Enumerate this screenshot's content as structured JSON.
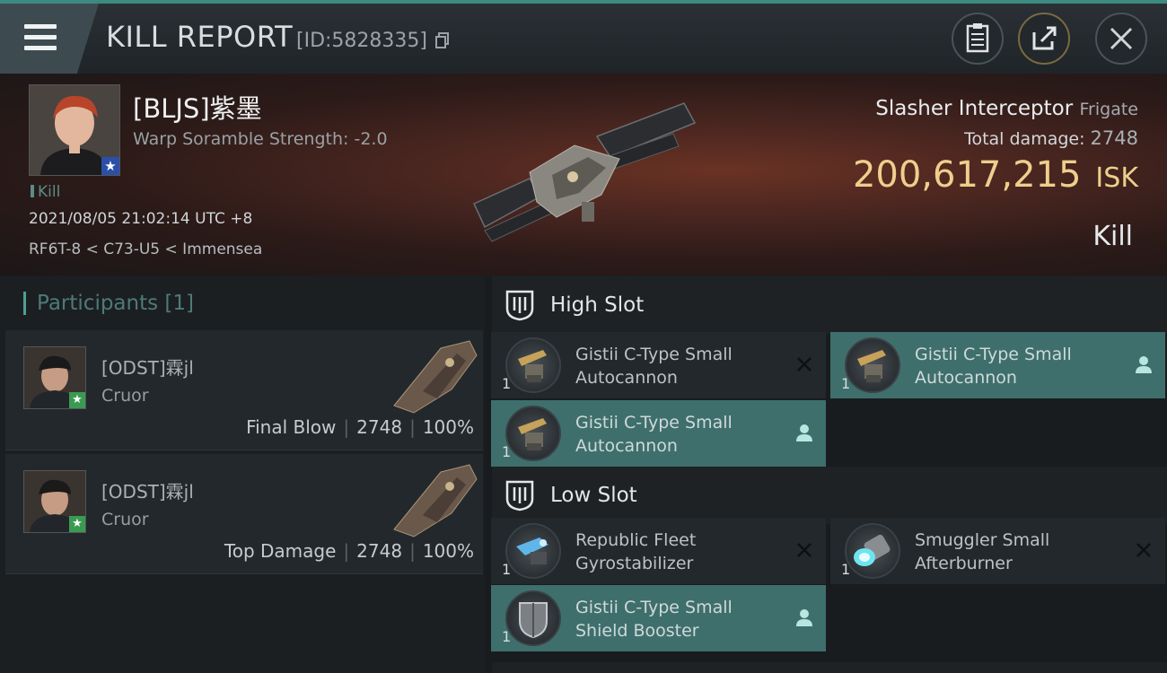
{
  "window": {
    "title": "KILL REPORT",
    "kill_id": "[ID:5828335]"
  },
  "victim": {
    "name": "[BLJS]紫墨",
    "warp_scramble": "Warp Soramble Strength: -2.0",
    "tag": "Kill",
    "datetime": "2021/08/05 21:02:14 UTC +8",
    "location": "RF6T-8 < C73-U5 < Immensea"
  },
  "ship": {
    "name": "Slasher Interceptor",
    "class": "Frigate",
    "total_damage_label": "Total damage:",
    "total_damage": "2748",
    "isk_value": "200,617,215",
    "isk_unit": "ISK",
    "result": "Kill"
  },
  "participants": {
    "header": "Participants [1]",
    "items": [
      {
        "name": "[ODST]霖jl",
        "ship": "Cruor",
        "role": "Final Blow",
        "damage": "2748",
        "percent": "100%"
      },
      {
        "name": "[ODST]霖jl",
        "ship": "Cruor",
        "role": "Top Damage",
        "damage": "2748",
        "percent": "100%"
      }
    ]
  },
  "slots": {
    "high": {
      "title": "High Slot",
      "modules": [
        {
          "name_line1": "Gistii C-Type Small",
          "name_line2": "Autocannon",
          "qty": "1",
          "state": "destroyed"
        },
        {
          "name_line1": "Gistii C-Type Small",
          "name_line2": "Autocannon",
          "qty": "1",
          "state": "dropped"
        },
        {
          "name_line1": "Gistii C-Type Small",
          "name_line2": "Autocannon",
          "qty": "1",
          "state": "dropped"
        }
      ]
    },
    "low": {
      "title": "Low Slot",
      "modules": [
        {
          "name_line1": "Republic Fleet",
          "name_line2": "Gyrostabilizer",
          "qty": "1",
          "state": "destroyed"
        },
        {
          "name_line1": "Smuggler Small",
          "name_line2": "Afterburner",
          "qty": "1",
          "state": "destroyed"
        },
        {
          "name_line1": "Gistii C-Type Small",
          "name_line2": "Shield Booster",
          "qty": "1",
          "state": "dropped"
        }
      ]
    }
  },
  "colors": {
    "accent_teal": "#3e6f6c",
    "isk_gold": "#eecf8c",
    "participants_header": "#4f7a77"
  },
  "icons": [
    "menu-icon",
    "clipboard-icon",
    "share-icon",
    "close-icon",
    "star-icon",
    "slot-icon",
    "destroyed-x-icon",
    "person-icon"
  ]
}
